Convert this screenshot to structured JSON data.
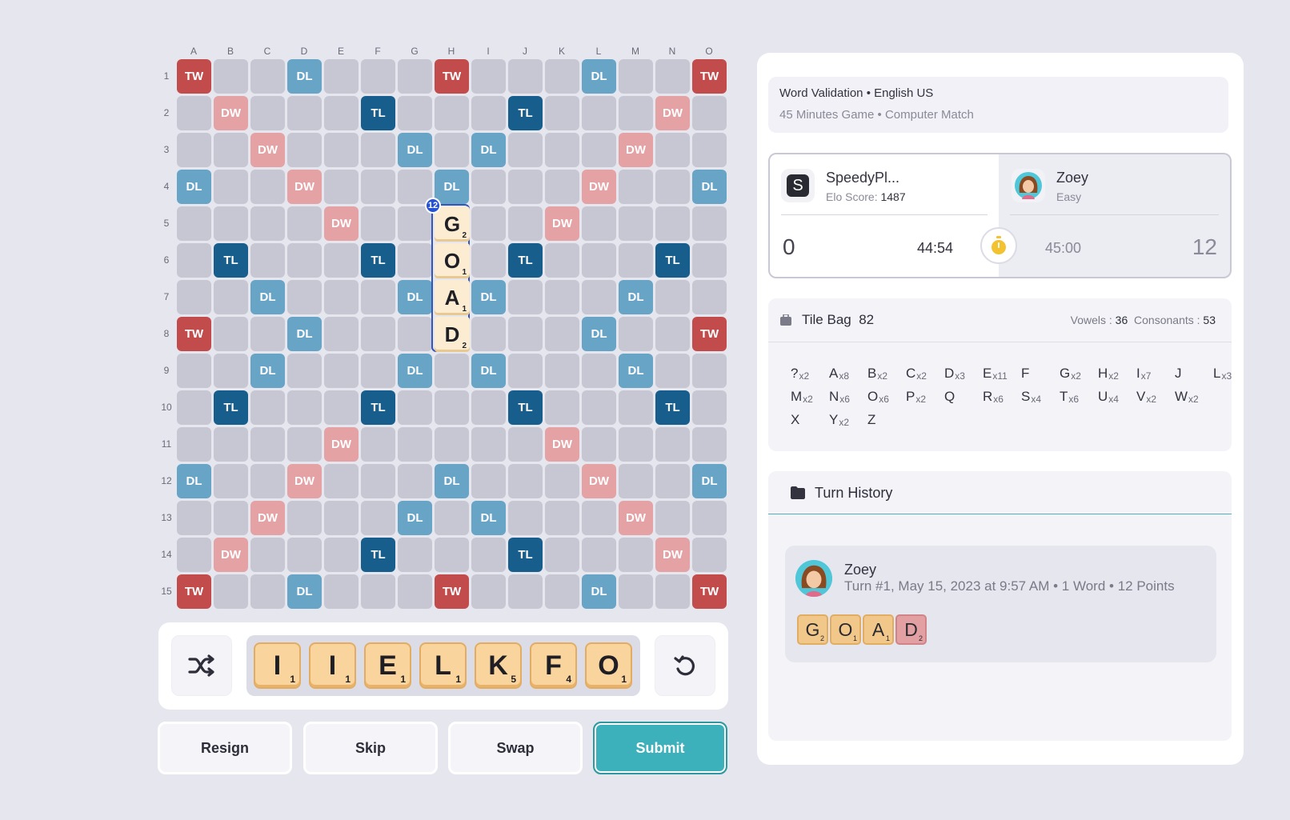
{
  "board": {
    "columns": [
      "A",
      "B",
      "C",
      "D",
      "E",
      "F",
      "G",
      "H",
      "I",
      "J",
      "K",
      "L",
      "M",
      "N",
      "O"
    ],
    "rows": [
      "1",
      "2",
      "3",
      "4",
      "5",
      "6",
      "7",
      "8",
      "9",
      "10",
      "11",
      "12",
      "13",
      "14",
      "15"
    ],
    "premium_rows": [
      [
        "TW",
        "",
        "",
        "DL",
        "",
        "",
        "",
        "TW",
        "",
        "",
        "",
        "DL",
        "",
        "",
        "TW"
      ],
      [
        "",
        "DW",
        "",
        "",
        "",
        "TL",
        "",
        "",
        "",
        "TL",
        "",
        "",
        "",
        "DW",
        ""
      ],
      [
        "",
        "",
        "DW",
        "",
        "",
        "",
        "DL",
        "",
        "DL",
        "",
        "",
        "",
        "DW",
        "",
        ""
      ],
      [
        "DL",
        "",
        "",
        "DW",
        "",
        "",
        "",
        "DL",
        "",
        "",
        "",
        "DW",
        "",
        "",
        "DL"
      ],
      [
        "",
        "",
        "",
        "",
        "DW",
        "",
        "",
        "",
        "",
        "",
        "DW",
        "",
        "",
        "",
        ""
      ],
      [
        "",
        "TL",
        "",
        "",
        "",
        "TL",
        "",
        "",
        "",
        "TL",
        "",
        "",
        "",
        "TL",
        ""
      ],
      [
        "",
        "",
        "DL",
        "",
        "",
        "",
        "DL",
        "",
        "DL",
        "",
        "",
        "",
        "DL",
        "",
        ""
      ],
      [
        "TW",
        "",
        "",
        "DL",
        "",
        "",
        "",
        "",
        "",
        "",
        "",
        "DL",
        "",
        "",
        "TW"
      ],
      [
        "",
        "",
        "DL",
        "",
        "",
        "",
        "DL",
        "",
        "DL",
        "",
        "",
        "",
        "DL",
        "",
        ""
      ],
      [
        "",
        "TL",
        "",
        "",
        "",
        "TL",
        "",
        "",
        "",
        "TL",
        "",
        "",
        "",
        "TL",
        ""
      ],
      [
        "",
        "",
        "",
        "",
        "DW",
        "",
        "",
        "",
        "",
        "",
        "DW",
        "",
        "",
        "",
        ""
      ],
      [
        "DL",
        "",
        "",
        "DW",
        "",
        "",
        "",
        "DL",
        "",
        "",
        "",
        "DW",
        "",
        "",
        "DL"
      ],
      [
        "",
        "",
        "DW",
        "",
        "",
        "",
        "DL",
        "",
        "DL",
        "",
        "",
        "",
        "DW",
        "",
        ""
      ],
      [
        "",
        "DW",
        "",
        "",
        "",
        "TL",
        "",
        "",
        "",
        "TL",
        "",
        "",
        "",
        "DW",
        ""
      ],
      [
        "TW",
        "",
        "",
        "DL",
        "",
        "",
        "",
        "TW",
        "",
        "",
        "",
        "DL",
        "",
        "",
        "TW"
      ]
    ],
    "placed_tiles": [
      {
        "letter": "G",
        "points": "2",
        "col": 7,
        "row": 4
      },
      {
        "letter": "O",
        "points": "1",
        "col": 7,
        "row": 5
      },
      {
        "letter": "A",
        "points": "1",
        "col": 7,
        "row": 6
      },
      {
        "letter": "D",
        "points": "2",
        "col": 7,
        "row": 7
      }
    ],
    "move_score": "12"
  },
  "rack": {
    "shuffle_icon": "shuffle-icon",
    "recall_icon": "recall-icon",
    "tiles": [
      {
        "letter": "I",
        "points": "1"
      },
      {
        "letter": "I",
        "points": "1"
      },
      {
        "letter": "E",
        "points": "1"
      },
      {
        "letter": "L",
        "points": "1"
      },
      {
        "letter": "K",
        "points": "5"
      },
      {
        "letter": "F",
        "points": "4"
      },
      {
        "letter": "O",
        "points": "1"
      }
    ]
  },
  "actions": {
    "resign": "Resign",
    "skip": "Skip",
    "swap": "Swap",
    "submit": "Submit"
  },
  "game_info": {
    "validation": "Word Validation",
    "language": "English US",
    "details": "45 Minutes Game • Computer Match"
  },
  "players": {
    "me": {
      "initial": "S",
      "name": "SpeedyPl...",
      "elo_label": "Elo Score:",
      "elo": "1487",
      "score": "0",
      "time": "44:54"
    },
    "opponent": {
      "name": "Zoey",
      "level": "Easy",
      "score": "12",
      "time": "45:00"
    }
  },
  "tile_bag": {
    "title": "Tile Bag",
    "count": "82",
    "vowels_label": "Vowels :",
    "vowels": "36",
    "consonants_label": "Consonants :",
    "consonants": "53",
    "letters": [
      {
        "l": "?",
        "c": "x2"
      },
      {
        "l": "A",
        "c": "x8"
      },
      {
        "l": "B",
        "c": "x2"
      },
      {
        "l": "C",
        "c": "x2"
      },
      {
        "l": "D",
        "c": "x3"
      },
      {
        "l": "E",
        "c": "x11"
      },
      {
        "l": "F",
        "c": ""
      },
      {
        "l": "G",
        "c": "x2"
      },
      {
        "l": "H",
        "c": "x2"
      },
      {
        "l": "I",
        "c": "x7"
      },
      {
        "l": "J",
        "c": ""
      },
      {
        "l": "L",
        "c": "x3"
      },
      {
        "l": "M",
        "c": "x2"
      },
      {
        "l": "N",
        "c": "x6"
      },
      {
        "l": "O",
        "c": "x6"
      },
      {
        "l": "P",
        "c": "x2"
      },
      {
        "l": "Q",
        "c": ""
      },
      {
        "l": "R",
        "c": "x6"
      },
      {
        "l": "S",
        "c": "x4"
      },
      {
        "l": "T",
        "c": "x6"
      },
      {
        "l": "U",
        "c": "x4"
      },
      {
        "l": "V",
        "c": "x2"
      },
      {
        "l": "W",
        "c": "x2"
      },
      {
        "l": "X",
        "c": ""
      },
      {
        "l": "Y",
        "c": "x2"
      },
      {
        "l": "Z",
        "c": ""
      }
    ]
  },
  "history": {
    "title": "Turn History",
    "turns": [
      {
        "player": "Zoey",
        "description": "Turn #1, May 15, 2023 at 9:57 AM • 1 Word • 12 Points",
        "tiles": [
          {
            "letter": "G",
            "points": "2",
            "premium": ""
          },
          {
            "letter": "O",
            "points": "1",
            "premium": ""
          },
          {
            "letter": "A",
            "points": "1",
            "premium": ""
          },
          {
            "letter": "D",
            "points": "2",
            "premium": "DW"
          }
        ]
      }
    ]
  },
  "colors": {
    "tw": "#c24b4b",
    "dw": "#e4a2a5",
    "tl": "#175e8c",
    "dl": "#68a4c6",
    "empty": "#c7c7d3",
    "submit": "#3db1bb",
    "tile": "#f9d49c"
  }
}
